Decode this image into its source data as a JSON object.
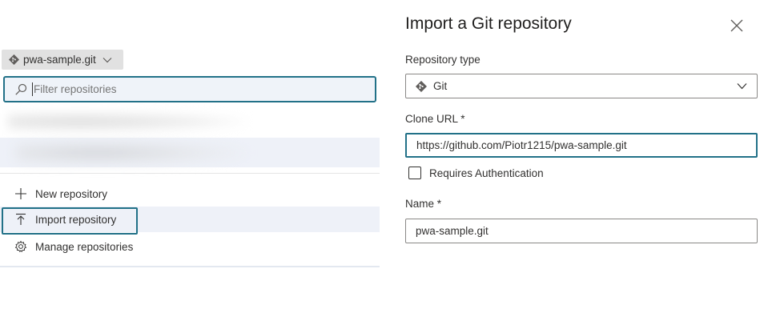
{
  "repo_selector": {
    "current_repo": "pwa-sample.git"
  },
  "filter": {
    "placeholder": "Filter repositories",
    "value": ""
  },
  "menu": {
    "new_repository": "New repository",
    "import_repository": "Import repository",
    "manage_repositories": "Manage repositories"
  },
  "dialog": {
    "title": "Import a Git repository",
    "repository_type_label": "Repository type",
    "repository_type_value": "Git",
    "clone_url_label": "Clone URL *",
    "clone_url_value": "https://github.com/Piotr1215/pwa-sample.git",
    "requires_auth_label": "Requires Authentication",
    "requires_auth_checked": false,
    "name_label": "Name *",
    "name_value": "pwa-sample.git"
  },
  "colors": {
    "focus_border": "#227188",
    "highlight_bg": "#eef1f8",
    "chip_bg": "#e1e1e1"
  },
  "icons": [
    "git-icon",
    "chevron-down-icon",
    "search-icon",
    "plus-icon",
    "upload-icon",
    "gear-icon",
    "close-icon"
  ]
}
